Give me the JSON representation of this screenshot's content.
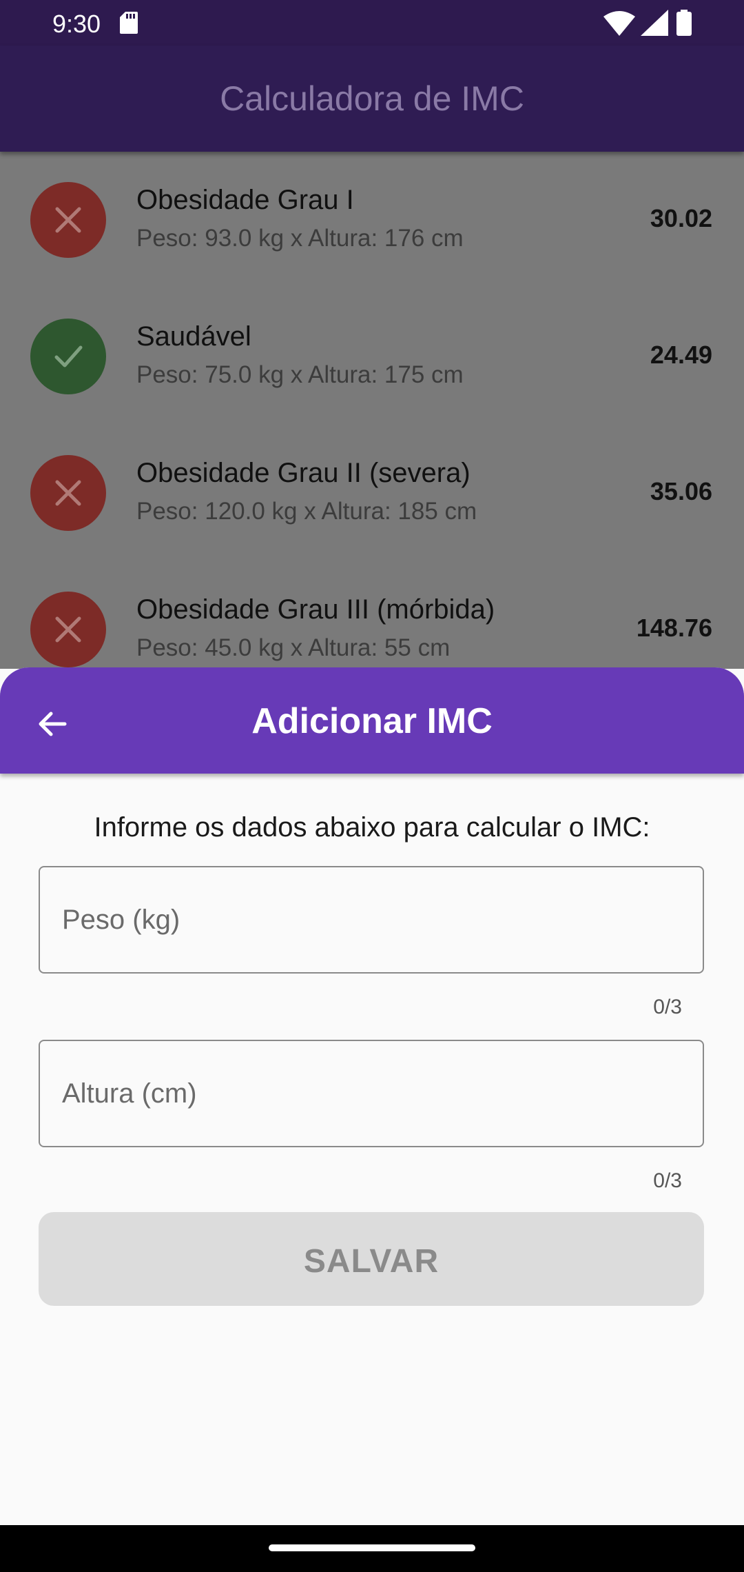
{
  "status_bar": {
    "time": "9:30",
    "icons": [
      "sd-card-icon",
      "wifi-icon",
      "signal-icon",
      "battery-icon"
    ]
  },
  "app_bar": {
    "title": "Calculadora de IMC"
  },
  "list": {
    "items": [
      {
        "title": "Obesidade Grau I",
        "subtitle": "Peso: 93.0 kg x Altura: 176 cm",
        "value": "30.02",
        "status": "bad",
        "icon": "close-icon"
      },
      {
        "title": "Saudável",
        "subtitle": "Peso: 75.0 kg x Altura: 175 cm",
        "value": "24.49",
        "status": "ok",
        "icon": "check-icon"
      },
      {
        "title": "Obesidade Grau II (severa)",
        "subtitle": "Peso: 120.0 kg x Altura: 185 cm",
        "value": "35.06",
        "status": "bad",
        "icon": "close-icon"
      },
      {
        "title": "Obesidade Grau III (mórbida)",
        "subtitle": "Peso: 45.0 kg x Altura: 55 cm",
        "value": "148.76",
        "status": "bad",
        "icon": "close-icon"
      }
    ]
  },
  "sheet": {
    "title": "Adicionar IMC",
    "back_icon": "arrow-back-icon",
    "instructions": "Informe os dados abaixo para calcular o IMC:",
    "weight_field": {
      "placeholder": "Peso (kg)",
      "value": "",
      "counter": "0/3"
    },
    "height_field": {
      "placeholder": "Altura (cm)",
      "value": "",
      "counter": "0/3"
    },
    "save_label": "SALVAR"
  },
  "colors": {
    "header_purple": "#673ab7",
    "status_bad": "#7d2b27",
    "status_ok": "#2e572f"
  }
}
